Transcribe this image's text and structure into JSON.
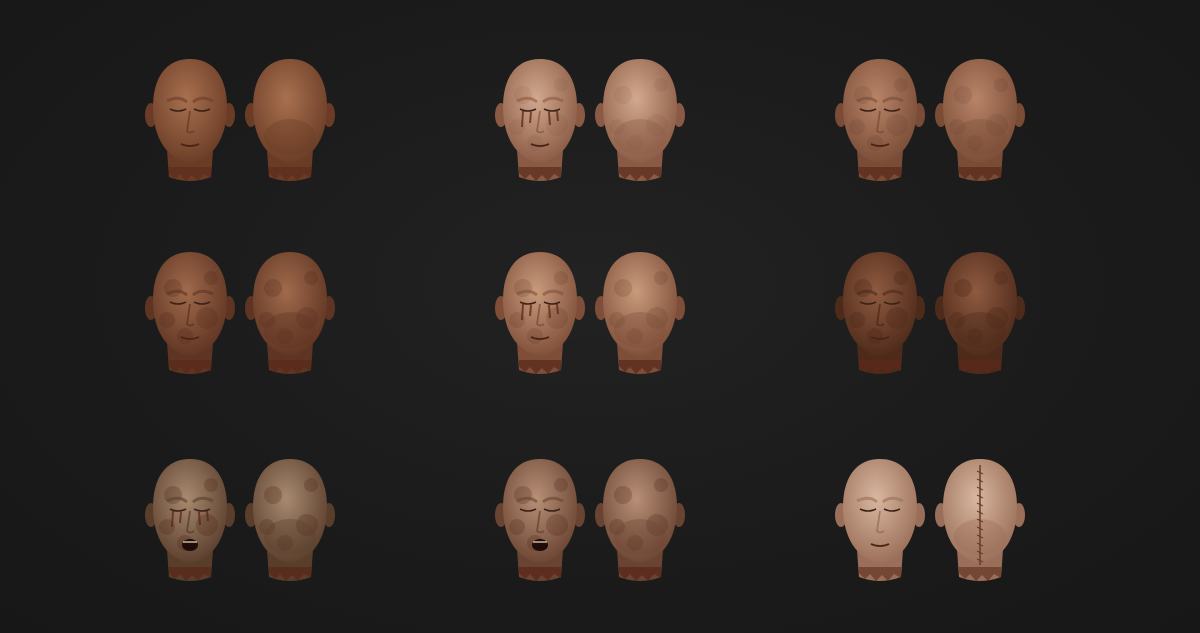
{
  "gallery": {
    "background": "#1b1b1b",
    "rows": [
      [
        {
          "id": "head-1",
          "skin": "#a8704f",
          "shade": "#6a3c26",
          "rot": 0.15,
          "stitch": false,
          "open_mouth": false,
          "eye_stain": false
        },
        {
          "id": "head-2",
          "skin": "#d2a98e",
          "shade": "#8a5a44",
          "rot": 0.35,
          "stitch": false,
          "open_mouth": false,
          "eye_stain": true
        },
        {
          "id": "head-3",
          "skin": "#b88468",
          "shade": "#7a4c36",
          "rot": 0.45,
          "stitch": false,
          "open_mouth": false,
          "eye_stain": false
        }
      ],
      [
        {
          "id": "head-4",
          "skin": "#a06a4c",
          "shade": "#5e3422",
          "rot": 0.7,
          "stitch": false,
          "open_mouth": false,
          "eye_stain": false
        },
        {
          "id": "head-5",
          "skin": "#c99b7c",
          "shade": "#7e4e38",
          "rot": 0.55,
          "stitch": false,
          "open_mouth": false,
          "eye_stain": true
        },
        {
          "id": "head-6",
          "skin": "#8e5a40",
          "shade": "#4e2a1a",
          "rot": 0.85,
          "stitch": false,
          "open_mouth": false,
          "eye_stain": false
        }
      ],
      [
        {
          "id": "head-7",
          "skin": "#a88a70",
          "shade": "#5a3e2c",
          "rot": 0.8,
          "stitch": false,
          "open_mouth": true,
          "eye_stain": true
        },
        {
          "id": "head-8",
          "skin": "#b89078",
          "shade": "#6a4432",
          "rot": 0.75,
          "stitch": false,
          "open_mouth": true,
          "eye_stain": false
        },
        {
          "id": "head-9",
          "skin": "#d8b7a0",
          "shade": "#9a6e58",
          "rot": 0.1,
          "stitch": true,
          "open_mouth": false,
          "eye_stain": false
        }
      ]
    ]
  }
}
